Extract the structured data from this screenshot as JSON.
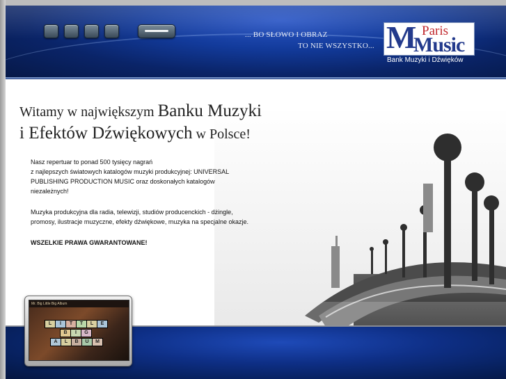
{
  "header": {
    "slogan_line1": "... BO SŁOWO I OBRAZ",
    "slogan_line2": "TO NIE WSZYSTKO...",
    "nav_buttons": [
      "nav-1",
      "nav-2",
      "nav-3",
      "nav-4",
      "nav-menu"
    ],
    "logo": {
      "paris": "Paris",
      "music": "Music",
      "m": "M",
      "subtitle": "Bank Muzyki i Dźwięków"
    },
    "colors": {
      "header_blue": "#0a2468",
      "logo_blue": "#233a8c",
      "logo_red": "#c0262b"
    }
  },
  "headline": {
    "line1_small": "Witamy w największym ",
    "line1_big": "Banku Muzyki",
    "line2_big": "i Efektów Dźwiękowych",
    "line2_small": " w Polsce!"
  },
  "body": {
    "p1_line1": "Nasz repertuar to ponad 500 tysięcy nagrań",
    "p1_line2": "z najlepszych światowych katalogów muzyki produkcyjnej:  UNIVERSAL",
    "p1_line3": "PUBLISHING PRODUCTION MUSIC oraz doskonałych katalogów",
    "p1_line4": "niezależnych!",
    "p2_line1": "Muzyka produkcyjna dla radia, telewizji, studiów producenckich - dżingle,",
    "p2_line2": "promosy, ilustracje muzyczne, efekty dźwiękowe, muzyka na specjalne okazje.",
    "p3": "WSZELKIE PRAWA GWARANTOWANE!"
  },
  "album": {
    "caption": "Mr. Big Little Big Album",
    "blocks": [
      "L",
      "I",
      "T",
      "T",
      "L",
      "E",
      "B",
      "I",
      "G",
      "A",
      "L",
      "B",
      "U",
      "M"
    ]
  }
}
